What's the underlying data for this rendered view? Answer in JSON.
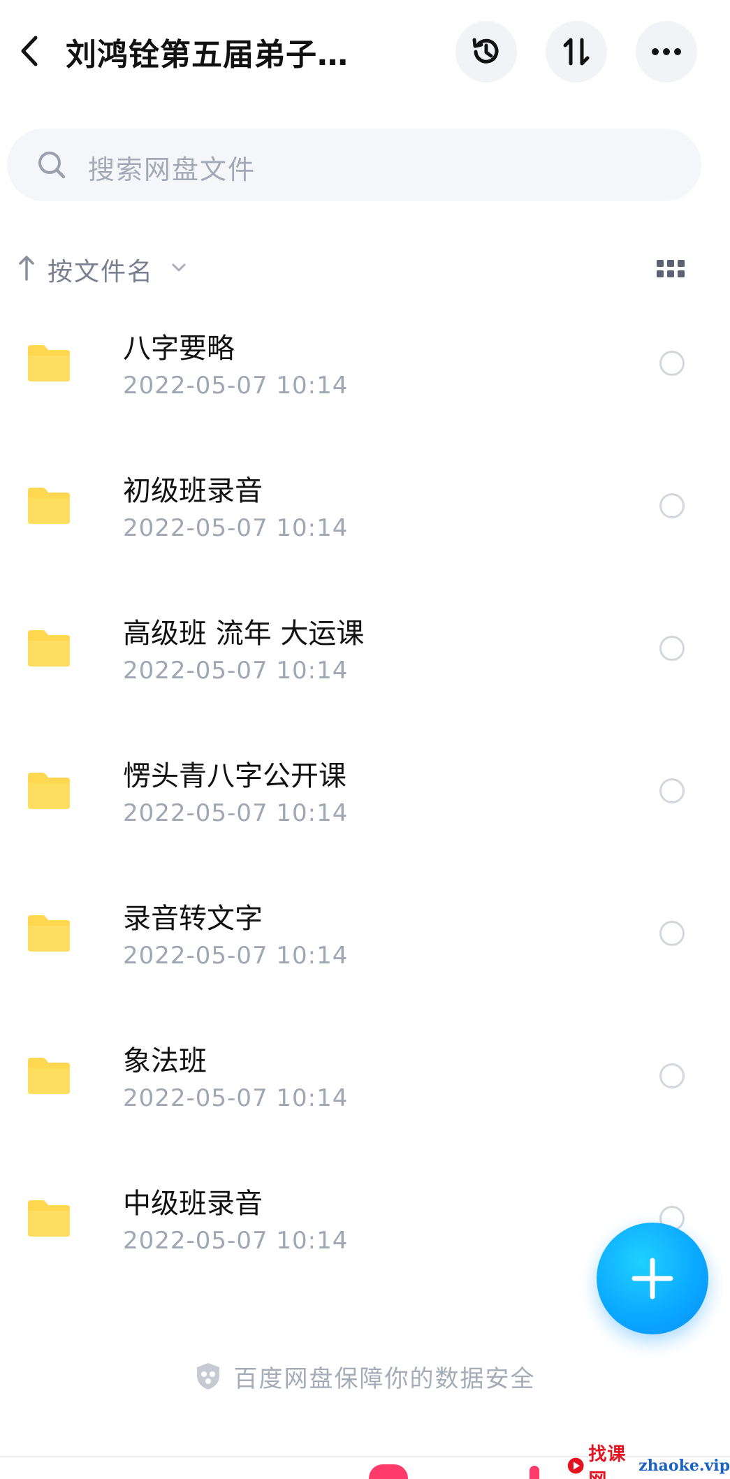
{
  "header": {
    "title": "刘鸿铨第五届弟子…",
    "icons": {
      "back": "chevron-left-icon",
      "history": "history-clock-icon",
      "sort": "sort-updown-icon",
      "more": "more-dots-icon"
    }
  },
  "search": {
    "placeholder": "搜索网盘文件",
    "icon": "search-icon"
  },
  "sort": {
    "label": "按文件名",
    "direction_icon": "arrow-up-icon",
    "view_icon": "grid-view-icon"
  },
  "files": [
    {
      "name": "八字要略",
      "date": "2022-05-07  10:14"
    },
    {
      "name": "初级班录音",
      "date": "2022-05-07  10:14"
    },
    {
      "name": "高级班 流年 大运课",
      "date": "2022-05-07  10:14"
    },
    {
      "name": "愣头青八字公开课",
      "date": "2022-05-07  10:14"
    },
    {
      "name": "录音转文字",
      "date": "2022-05-07  10:14"
    },
    {
      "name": "象法班",
      "date": "2022-05-07  10:14"
    },
    {
      "name": "中级班录音",
      "date": "2022-05-07  10:14"
    }
  ],
  "footer": {
    "safety_text": "百度网盘保障你的数据安全"
  },
  "watermark": {
    "cn": "找课网",
    "en": "zhaoke.vip"
  },
  "colors": {
    "folder": "#ffd84f",
    "fab": "#0aa6ff",
    "secondary_text": "#a1a6b3"
  }
}
